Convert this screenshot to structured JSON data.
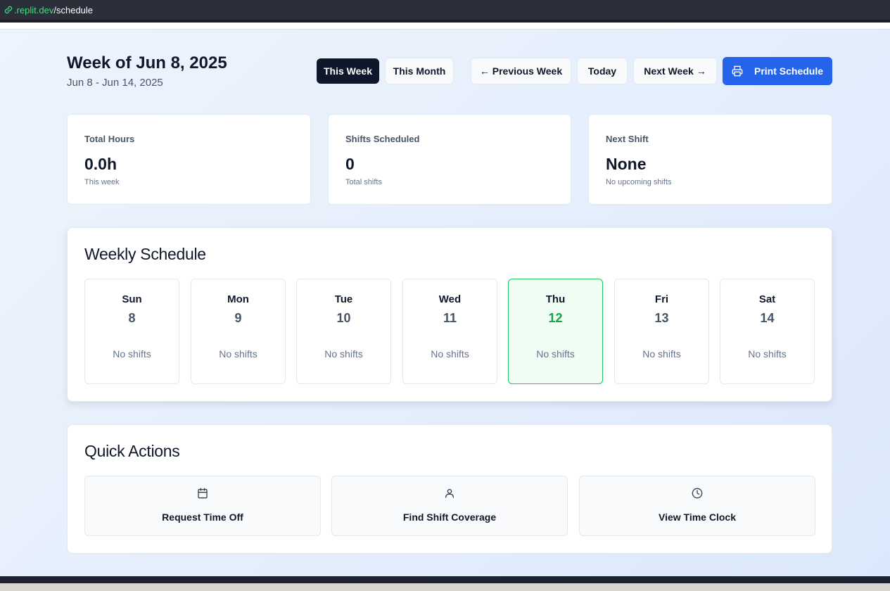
{
  "browser": {
    "url_domain": ".replit.dev",
    "url_path": "/schedule"
  },
  "header": {
    "title": "Week of Jun 8, 2025",
    "subtitle": "Jun 8 - Jun 14, 2025"
  },
  "toolbar": {
    "this_week": "This Week",
    "this_month": "This Month",
    "previous_week": "← Previous Week",
    "today": "Today",
    "next_week": "Next Week →",
    "print": "Print Schedule",
    "print_icon": "printer-icon",
    "accent_color": "#2563eb"
  },
  "stats": [
    {
      "label": "Total Hours",
      "value": "0.0h",
      "note": "This week"
    },
    {
      "label": "Shifts Scheduled",
      "value": "0",
      "note": "Total shifts"
    },
    {
      "label": "Next Shift",
      "value": "None",
      "note": "No upcoming shifts"
    }
  ],
  "schedule": {
    "title": "Weekly Schedule",
    "today_color": "#16a34a",
    "days": [
      {
        "name": "Sun",
        "date": "8",
        "status": "No shifts"
      },
      {
        "name": "Mon",
        "date": "9",
        "status": "No shifts"
      },
      {
        "name": "Tue",
        "date": "10",
        "status": "No shifts"
      },
      {
        "name": "Wed",
        "date": "11",
        "status": "No shifts"
      },
      {
        "name": "Thu",
        "date": "12",
        "status": "No shifts"
      },
      {
        "name": "Fri",
        "date": "13",
        "status": "No shifts"
      },
      {
        "name": "Sat",
        "date": "14",
        "status": "No shifts"
      }
    ]
  },
  "quick_actions": {
    "title": "Quick Actions",
    "items": [
      {
        "label": "Request Time Off",
        "icon": "calendar-icon"
      },
      {
        "label": "Find Shift Coverage",
        "icon": "user-icon"
      },
      {
        "label": "View Time Clock",
        "icon": "clock-icon"
      }
    ]
  }
}
